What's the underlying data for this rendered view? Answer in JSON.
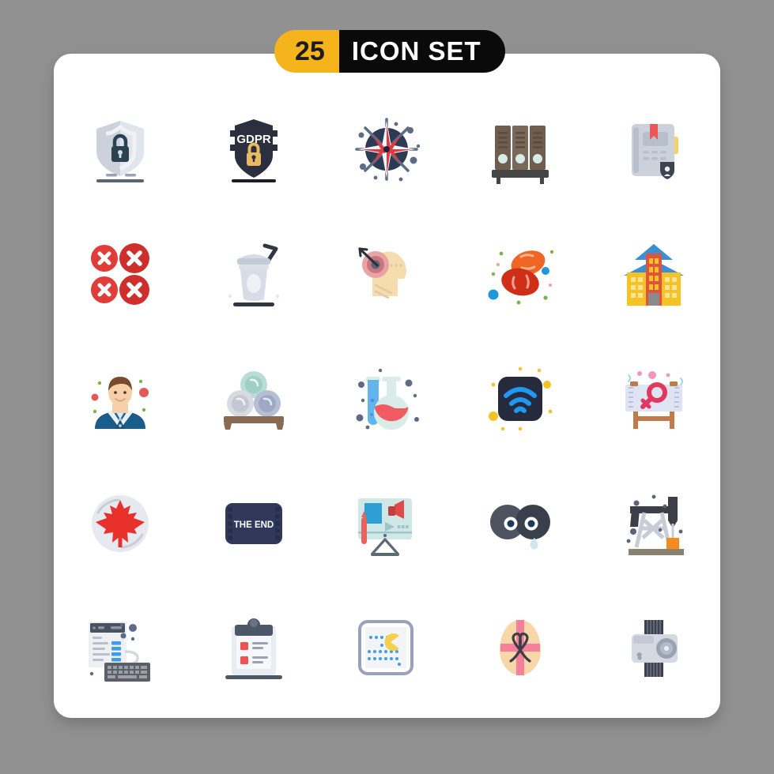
{
  "background_color": "#919191",
  "card": {
    "background_color": "#ffffff"
  },
  "header": {
    "count": "25",
    "title": "ICON SET",
    "count_bg": "#f5b31c",
    "title_bg": "#0a0a0a",
    "count_color": "#1c1c1c",
    "title_color": "#ffffff"
  },
  "grid": {
    "columns": 5,
    "rows": 5,
    "total": 25
  },
  "icons": [
    {
      "index": 1,
      "name": "shield-lock-icon",
      "label": "Shield with padlock",
      "row": 1,
      "col": 1,
      "colors": [
        "#ccd1dc",
        "#e4e8ef",
        "#2b4250",
        "#5a6473"
      ]
    },
    {
      "index": 2,
      "name": "gdpr-shield-icon",
      "label": "GDPR shield",
      "row": 1,
      "col": 2,
      "text": "GDPR",
      "colors": [
        "#2b2f3e",
        "#e8bb62",
        "#1b1e29"
      ]
    },
    {
      "index": 3,
      "name": "compass-rose-icon",
      "label": "Compass rose navigation",
      "row": 1,
      "col": 3,
      "colors": [
        "#2d3a54",
        "#e0393e",
        "#f2f4f7",
        "#5d6b86"
      ]
    },
    {
      "index": 4,
      "name": "binder-folders-icon",
      "label": "Binder folders on shelf",
      "row": 1,
      "col": 4,
      "colors": [
        "#6f5d4f",
        "#5c4d42",
        "#454545",
        "#d8ece6"
      ]
    },
    {
      "index": 5,
      "name": "notebook-bookmark-icon",
      "label": "Notebook with bookmark",
      "row": 1,
      "col": 5,
      "colors": [
        "#ccd1dc",
        "#b9c0cd",
        "#eb5757",
        "#f7d06a",
        "#3c4452"
      ]
    },
    {
      "index": 6,
      "name": "error-crosses-icon",
      "label": "Four red error crosses",
      "row": 2,
      "col": 1,
      "colors": [
        "#e03c39",
        "#cc2f2c",
        "#ffffff"
      ]
    },
    {
      "index": 7,
      "name": "smoothie-cup-icon",
      "label": "Smoothie cup with straw",
      "row": 2,
      "col": 2,
      "colors": [
        "#d7dce6",
        "#c3cad8",
        "#eef1f6",
        "#2f3742"
      ]
    },
    {
      "index": 8,
      "name": "head-target-arrow-icon",
      "label": "Head with target and arrow",
      "row": 2,
      "col": 3,
      "colors": [
        "#f5ddb0",
        "#e9a2a5",
        "#c8757e",
        "#5d6377",
        "#2b3138"
      ]
    },
    {
      "index": 9,
      "name": "blood-cells-icon",
      "label": "Blood cells",
      "row": 2,
      "col": 4,
      "colors": [
        "#ef6523",
        "#cf2e17",
        "#2196d8",
        "#7cb342"
      ]
    },
    {
      "index": 10,
      "name": "apartment-building-icon",
      "label": "Apartment building",
      "row": 2,
      "col": 5,
      "colors": [
        "#f5c324",
        "#e2533f",
        "#3d8fd4",
        "#8a8a8a"
      ]
    },
    {
      "index": 11,
      "name": "businessman-avatar-icon",
      "label": "Businessman avatar",
      "row": 3,
      "col": 1,
      "colors": [
        "#1a5c8a",
        "#0f4a72",
        "#f5d0a9",
        "#7b4a2a",
        "#e05a5a"
      ]
    },
    {
      "index": 12,
      "name": "stacked-plates-icon",
      "label": "Stacked plates on shelf",
      "row": 3,
      "col": 2,
      "colors": [
        "#b9ded6",
        "#d8dbe2",
        "#b6bed4",
        "#8a6a52"
      ]
    },
    {
      "index": 13,
      "name": "lab-flask-tube-icon",
      "label": "Lab flask and test tube",
      "row": 3,
      "col": 3,
      "colors": [
        "#62b4ec",
        "#d9ece8",
        "#ef5d63",
        "#5d6b86"
      ]
    },
    {
      "index": 14,
      "name": "wifi-signal-icon",
      "label": "WiFi signal",
      "row": 3,
      "col": 4,
      "colors": [
        "#252b3d",
        "#2196f3",
        "#f5c324"
      ]
    },
    {
      "index": 15,
      "name": "gender-sign-board-icon",
      "label": "Female gender sign board",
      "row": 3,
      "col": 5,
      "colors": [
        "#dfe4f5",
        "#e0385f",
        "#c17b4a",
        "#f196b4"
      ]
    },
    {
      "index": 16,
      "name": "canada-maple-leaf-icon",
      "label": "Canada maple leaf badge",
      "row": 4,
      "col": 1,
      "colors": [
        "#e6e9ef",
        "#e8312a",
        "#c9cdd6"
      ]
    },
    {
      "index": 17,
      "name": "the-end-film-icon",
      "label": "The End film strip",
      "row": 4,
      "col": 2,
      "text": "THE END",
      "colors": [
        "#30395a",
        "#262e4a",
        "#ffffff"
      ]
    },
    {
      "index": 18,
      "name": "video-marketing-icon",
      "label": "Video marketing board",
      "row": 4,
      "col": 3,
      "colors": [
        "#cfe7e6",
        "#2e9fd4",
        "#e04a4a",
        "#5c6a72"
      ]
    },
    {
      "index": 19,
      "name": "binoculars-tear-icon",
      "label": "Binoculars with teardrop",
      "row": 4,
      "col": 4,
      "colors": [
        "#4d535f",
        "#3a404b",
        "#ffffff",
        "#1b3a57",
        "#cfe6ea"
      ]
    },
    {
      "index": 20,
      "name": "oil-pump-jack-icon",
      "label": "Oil pump jack derrick",
      "row": 4,
      "col": 5,
      "colors": [
        "#3c3f47",
        "#c8ccd6",
        "#f38b1e",
        "#8a8170"
      ]
    },
    {
      "index": 21,
      "name": "web-coding-keyboard-icon",
      "label": "Web page with keyboard",
      "row": 5,
      "col": 1,
      "colors": [
        "#eef0f3",
        "#4a5160",
        "#3f9ce8",
        "#5c5f66"
      ]
    },
    {
      "index": 22,
      "name": "clipboard-checklist-icon",
      "label": "Clipboard checklist",
      "row": 5,
      "col": 2,
      "colors": [
        "#e8ecf3",
        "#4e5767",
        "#ef5350",
        "#9aa3b2"
      ]
    },
    {
      "index": 23,
      "name": "arcade-game-screen-icon",
      "label": "Retro arcade game screen",
      "row": 5,
      "col": 3,
      "colors": [
        "#f2f4f8",
        "#9aa0c0",
        "#f5cf4e",
        "#3f9ce8"
      ]
    },
    {
      "index": 24,
      "name": "easter-egg-ribbon-icon",
      "label": "Easter egg with ribbon",
      "row": 5,
      "col": 4,
      "colors": [
        "#f7d7a8",
        "#f4809b",
        "#3c3f47"
      ]
    },
    {
      "index": 25,
      "name": "action-camera-icon",
      "label": "Action sports camera",
      "row": 5,
      "col": 5,
      "colors": [
        "#d5d9e2",
        "#eef0f4",
        "#3c4150",
        "#9aa3b2"
      ]
    }
  ]
}
